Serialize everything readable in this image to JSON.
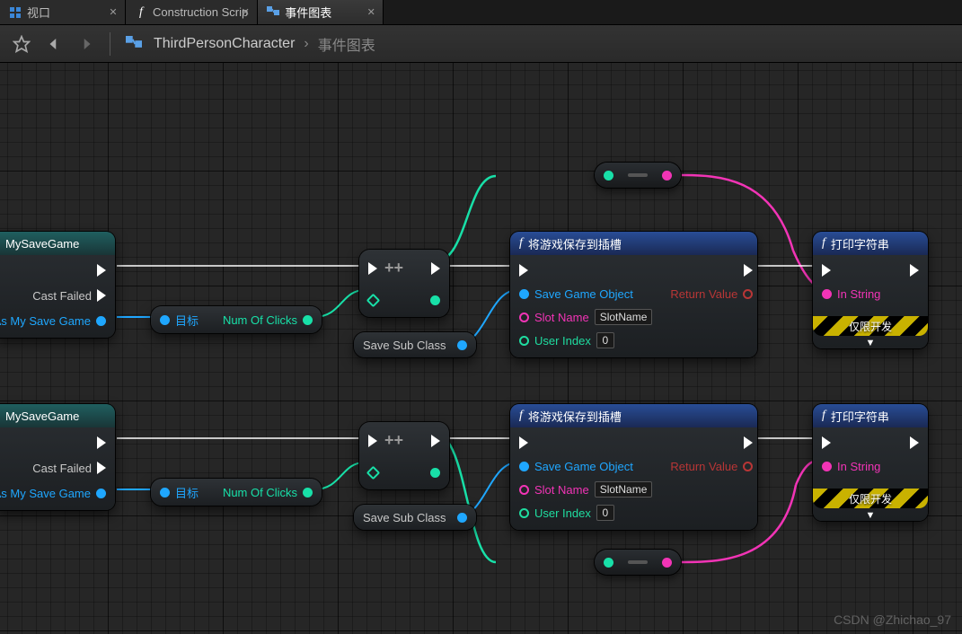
{
  "tabs": [
    {
      "label": "视口"
    },
    {
      "label": "Construction Scrip"
    },
    {
      "label": "事件图表"
    }
  ],
  "breadcrumb": {
    "root": "ThirdPersonCharacter",
    "current": "事件图表"
  },
  "cast": {
    "title": "MySaveGame",
    "failed": "Cast Failed",
    "asOut": "As My Save Game"
  },
  "getNode": {
    "target": "目标",
    "out": "Num Of Clicks"
  },
  "incNode": {
    "op": "++",
    "subOut": "Save Sub Class"
  },
  "saveNode": {
    "title": "将游戏保存到插槽",
    "obj": "Save Game Object",
    "slot": "Slot Name",
    "slotVal": "SlotName",
    "idx": "User Index",
    "idxVal": "0",
    "ret": "Return Value"
  },
  "printNode": {
    "title": "打印字符串",
    "inStr": "In String",
    "dev": "仅限开发"
  },
  "watermark": "CSDN @Zhichao_97"
}
